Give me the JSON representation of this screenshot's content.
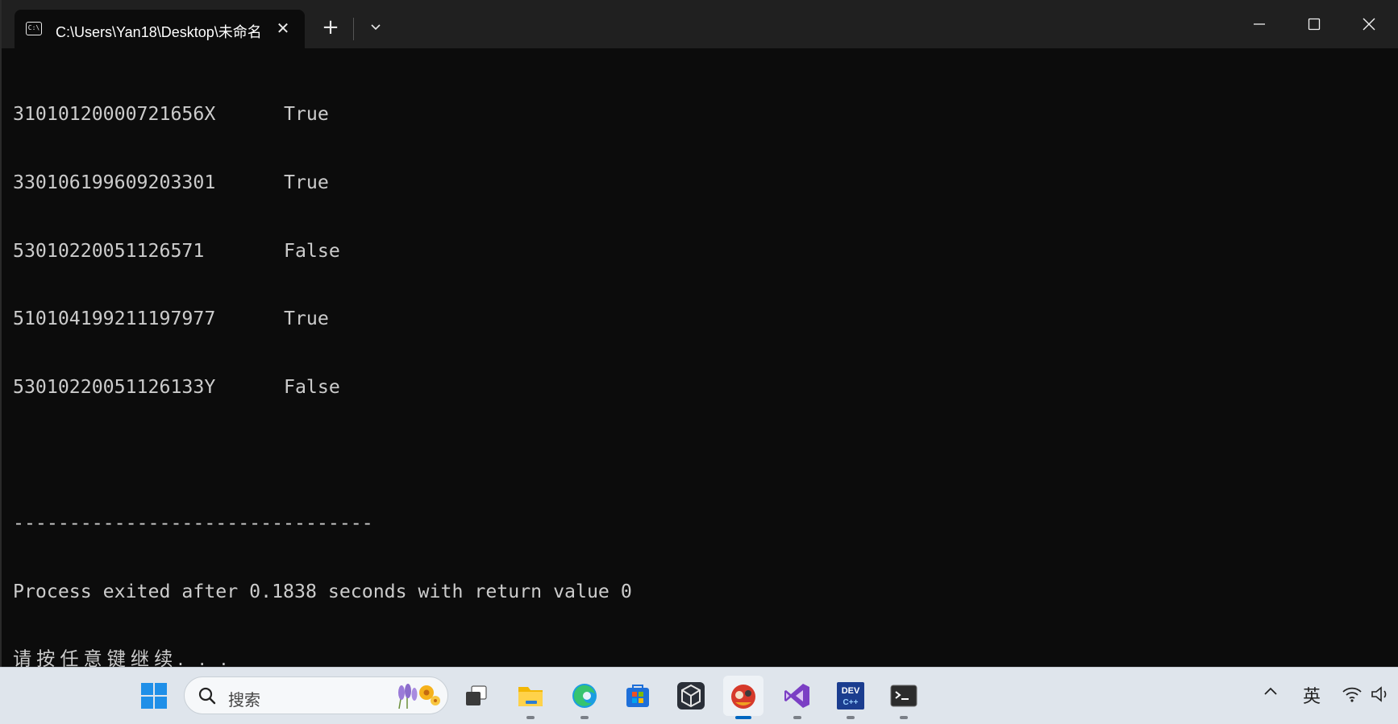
{
  "window": {
    "tab_title": "C:\\Users\\Yan18\\Desktop\\未命名",
    "tab_icon_text": "C:\\",
    "new_tab_label": "+",
    "minimize_label": "Minimize",
    "maximize_label": "Maximize",
    "close_label": "Close"
  },
  "console": {
    "rows": [
      {
        "id": "31010120000721656X",
        "result": "True"
      },
      {
        "id": "330106199609203301",
        "result": "True"
      },
      {
        "id": "53010220051126571",
        "result": "False"
      },
      {
        "id": "510104199211197977",
        "result": "True"
      },
      {
        "id": "53010220051126133Y",
        "result": "False"
      }
    ],
    "separator": "--------------------------------",
    "process_line": "Process exited after 0.1838 seconds with return value 0",
    "prompt_line": "请按任意键继续. . ."
  },
  "taskbar": {
    "search_placeholder": "搜索",
    "apps": [
      "start-icon",
      "task-view-icon",
      "file-explorer-icon",
      "edge-icon",
      "store-icon",
      "unity-icon",
      "game-app-icon",
      "visual-studio-icon",
      "dev-cpp-icon",
      "terminal-icon"
    ],
    "dev_cpp_label_top": "DEV",
    "dev_cpp_label_bottom": "C++",
    "ime_indicator": "英"
  },
  "colors": {
    "console_bg": "#0c0c0c",
    "console_text": "#cccccc",
    "titlebar_bg": "#202020",
    "taskbar_bg": "#dfe5ec",
    "accent": "#0067c0"
  }
}
